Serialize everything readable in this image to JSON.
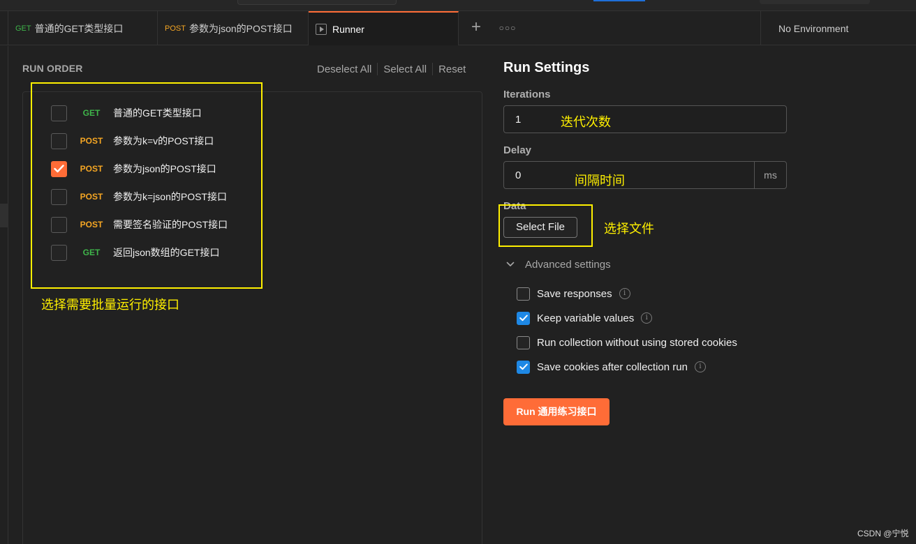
{
  "tabs": [
    {
      "method": "GET",
      "label": "普通的GET类型接口"
    },
    {
      "method": "POST",
      "label": "参数为json的POST接口"
    },
    {
      "label": "Runner"
    }
  ],
  "environment": "No Environment",
  "run_order": {
    "title": "RUN ORDER",
    "deselect_all": "Deselect All",
    "select_all": "Select All",
    "reset": "Reset",
    "requests": [
      {
        "method": "GET",
        "name": "普通的GET类型接口",
        "checked": false
      },
      {
        "method": "POST",
        "name": "参数为k=v的POST接口",
        "checked": false
      },
      {
        "method": "POST",
        "name": "参数为json的POST接口",
        "checked": true
      },
      {
        "method": "POST",
        "name": "参数为k=json的POST接口",
        "checked": false
      },
      {
        "method": "POST",
        "name": "需要签名验证的POST接口",
        "checked": false
      },
      {
        "method": "GET",
        "name": "返回json数组的GET接口",
        "checked": false
      }
    ]
  },
  "run_settings": {
    "title": "Run Settings",
    "iterations_label": "Iterations",
    "iterations_value": "1",
    "delay_label": "Delay",
    "delay_value": "0",
    "delay_unit": "ms",
    "data_label": "Data",
    "select_file": "Select File",
    "advanced_settings": "Advanced settings",
    "options": [
      {
        "label": "Save responses",
        "checked": false,
        "info": true
      },
      {
        "label": "Keep variable values",
        "checked": true,
        "info": true
      },
      {
        "label": "Run collection without using stored cookies",
        "checked": false,
        "info": false
      },
      {
        "label": "Save cookies after collection run",
        "checked": true,
        "info": true
      }
    ],
    "run_button": "Run 通用练习接口"
  },
  "annotations": {
    "iterations_note": "迭代次数",
    "delay_note": "间隔时间",
    "file_note": "选择文件",
    "requests_note": "选择需要批量运行的接口"
  },
  "watermark": "CSDN @宁悦",
  "colors": {
    "accent": "#ff6c37",
    "checkbox_blue": "#1e88e5",
    "get": "#3fb54a",
    "post": "#f5a623",
    "annotation": "#fff000"
  }
}
